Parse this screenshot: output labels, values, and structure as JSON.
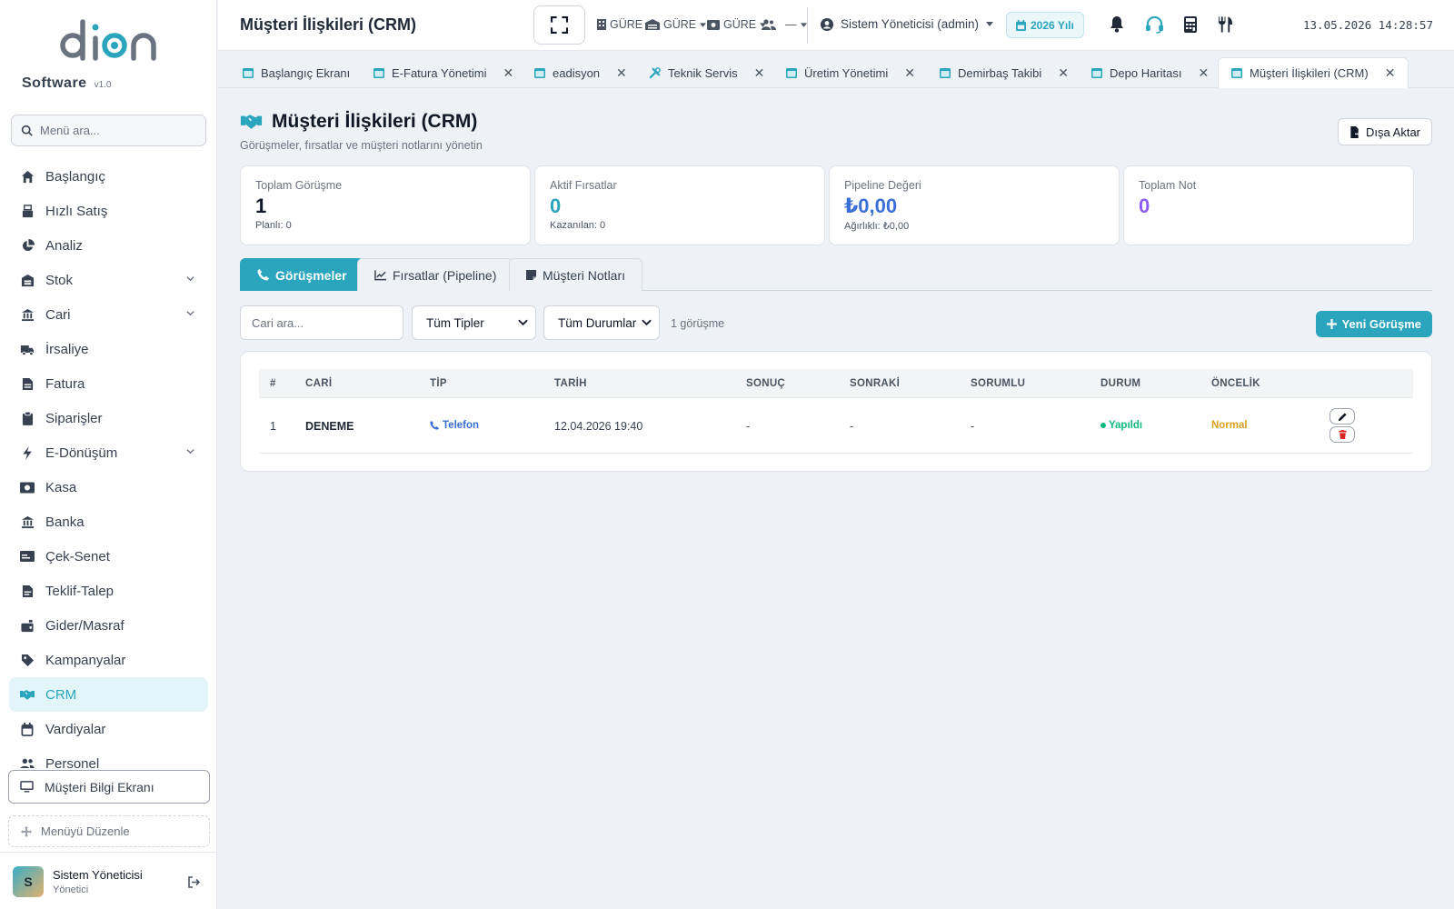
{
  "brand": {
    "logo_text": "dion",
    "name": "Software",
    "version": "v1.0"
  },
  "sidebar": {
    "search_placeholder": "Menü ara...",
    "items": [
      {
        "label": "Başlangıç",
        "icon": "home-icon"
      },
      {
        "label": "Hızlı Satış",
        "icon": "cash-register-icon"
      },
      {
        "label": "Analiz",
        "icon": "pie-chart-icon"
      },
      {
        "label": "Stok",
        "icon": "warehouse-icon",
        "expandable": true
      },
      {
        "label": "Cari",
        "icon": "bank-icon",
        "expandable": true
      },
      {
        "label": "İrsaliye",
        "icon": "truck-icon"
      },
      {
        "label": "Fatura",
        "icon": "invoice-icon"
      },
      {
        "label": "Siparişler",
        "icon": "clipboard-icon"
      },
      {
        "label": "E-Dönüşüm",
        "icon": "bolt-icon",
        "expandable": true
      },
      {
        "label": "Kasa",
        "icon": "money-icon"
      },
      {
        "label": "Banka",
        "icon": "bank-icon"
      },
      {
        "label": "Çek-Senet",
        "icon": "card-icon"
      },
      {
        "label": "Teklif-Talep",
        "icon": "document-icon"
      },
      {
        "label": "Gider/Masraf",
        "icon": "expense-icon"
      },
      {
        "label": "Kampanyalar",
        "icon": "tag-icon"
      },
      {
        "label": "CRM",
        "icon": "handshake-icon",
        "active": true
      },
      {
        "label": "Vardiyalar",
        "icon": "calendar-icon"
      },
      {
        "label": "Personel",
        "icon": "users-icon"
      }
    ],
    "customer_screen": "Müşteri Bilgi Ekranı",
    "edit_menu": "Menüyü Düzenle",
    "user": {
      "initial": "S",
      "name": "Sistem Yöneticisi",
      "role": "Yönetici"
    }
  },
  "topbar": {
    "title": "Müşteri İlişkileri (CRM)",
    "selectors": [
      {
        "label": "GÜRE",
        "icon": "building-icon"
      },
      {
        "label": "GÜRE",
        "icon": "warehouse-icon"
      },
      {
        "label": "GÜRE",
        "icon": "cash-register-icon"
      },
      {
        "label": "—",
        "icon": "user-group-icon"
      }
    ],
    "admin": "Sistem Yöneticisi (admin)",
    "year": "2026 Yılı",
    "datetime": "13.05.2026 14:28:57"
  },
  "tabs": [
    {
      "label": "Başlangıç Ekranı",
      "closable": false
    },
    {
      "label": "E-Fatura Yönetimi",
      "closable": true
    },
    {
      "label": "eadisyon",
      "closable": true
    },
    {
      "label": "Teknik Servis",
      "closable": true
    },
    {
      "label": "Üretim Yönetimi",
      "closable": true
    },
    {
      "label": "Demirbaş Takibi",
      "closable": true
    },
    {
      "label": "Depo Haritası",
      "closable": true
    },
    {
      "label": "Müşteri İlişkileri (CRM)",
      "closable": true,
      "active": true
    }
  ],
  "page": {
    "title": "Müşteri İlişkileri (CRM)",
    "subtitle": "Görüşmeler, fırsatlar ve müşteri notlarını yönetin",
    "export_label": "Dışa Aktar"
  },
  "stats": [
    {
      "label": "Toplam Görüşme",
      "value": "1",
      "sub": "Planlı: 0",
      "color": "#111827"
    },
    {
      "label": "Aktif Fırsatlar",
      "value": "0",
      "sub": "Kazanılan: 0",
      "color": "#2aa5bd"
    },
    {
      "label": "Pipeline Değeri",
      "value": "₺0,00",
      "sub": "Ağırlıklı: ₺0,00",
      "color": "#3b6fd8"
    },
    {
      "label": "Toplam Not",
      "value": "0",
      "sub": "",
      "color": "#8b5cf6"
    }
  ],
  "crm_tabs": [
    {
      "label": "Görüşmeler",
      "icon": "phone-icon",
      "active": true
    },
    {
      "label": "Fırsatlar (Pipeline)",
      "icon": "chart-line-icon"
    },
    {
      "label": "Müşteri Notları",
      "icon": "note-icon"
    }
  ],
  "filters": {
    "search_placeholder": "Cari ara...",
    "type_select": "Tüm Tipler",
    "status_select": "Tüm Durumlar",
    "count_text": "1 görüşme",
    "new_button": "Yeni Görüşme"
  },
  "table": {
    "columns": [
      "#",
      "CARİ",
      "TİP",
      "TARİH",
      "SONUÇ",
      "SONRAKİ",
      "SORUMLU",
      "DURUM",
      "ÖNCELİK"
    ],
    "rows": [
      {
        "no": "1",
        "cari": "DENEME",
        "tip": "Telefon",
        "tarih": "12.04.2026 19:40",
        "sonuc": "-",
        "sonraki": "-",
        "sorumlu": "-",
        "durum": "Yapıldı",
        "oncelik": "Normal"
      }
    ]
  },
  "colors": {
    "accent": "#2aa5bd",
    "status_done": "#10b981",
    "priority_normal": "#d9a01b",
    "delete": "#dc2626"
  }
}
